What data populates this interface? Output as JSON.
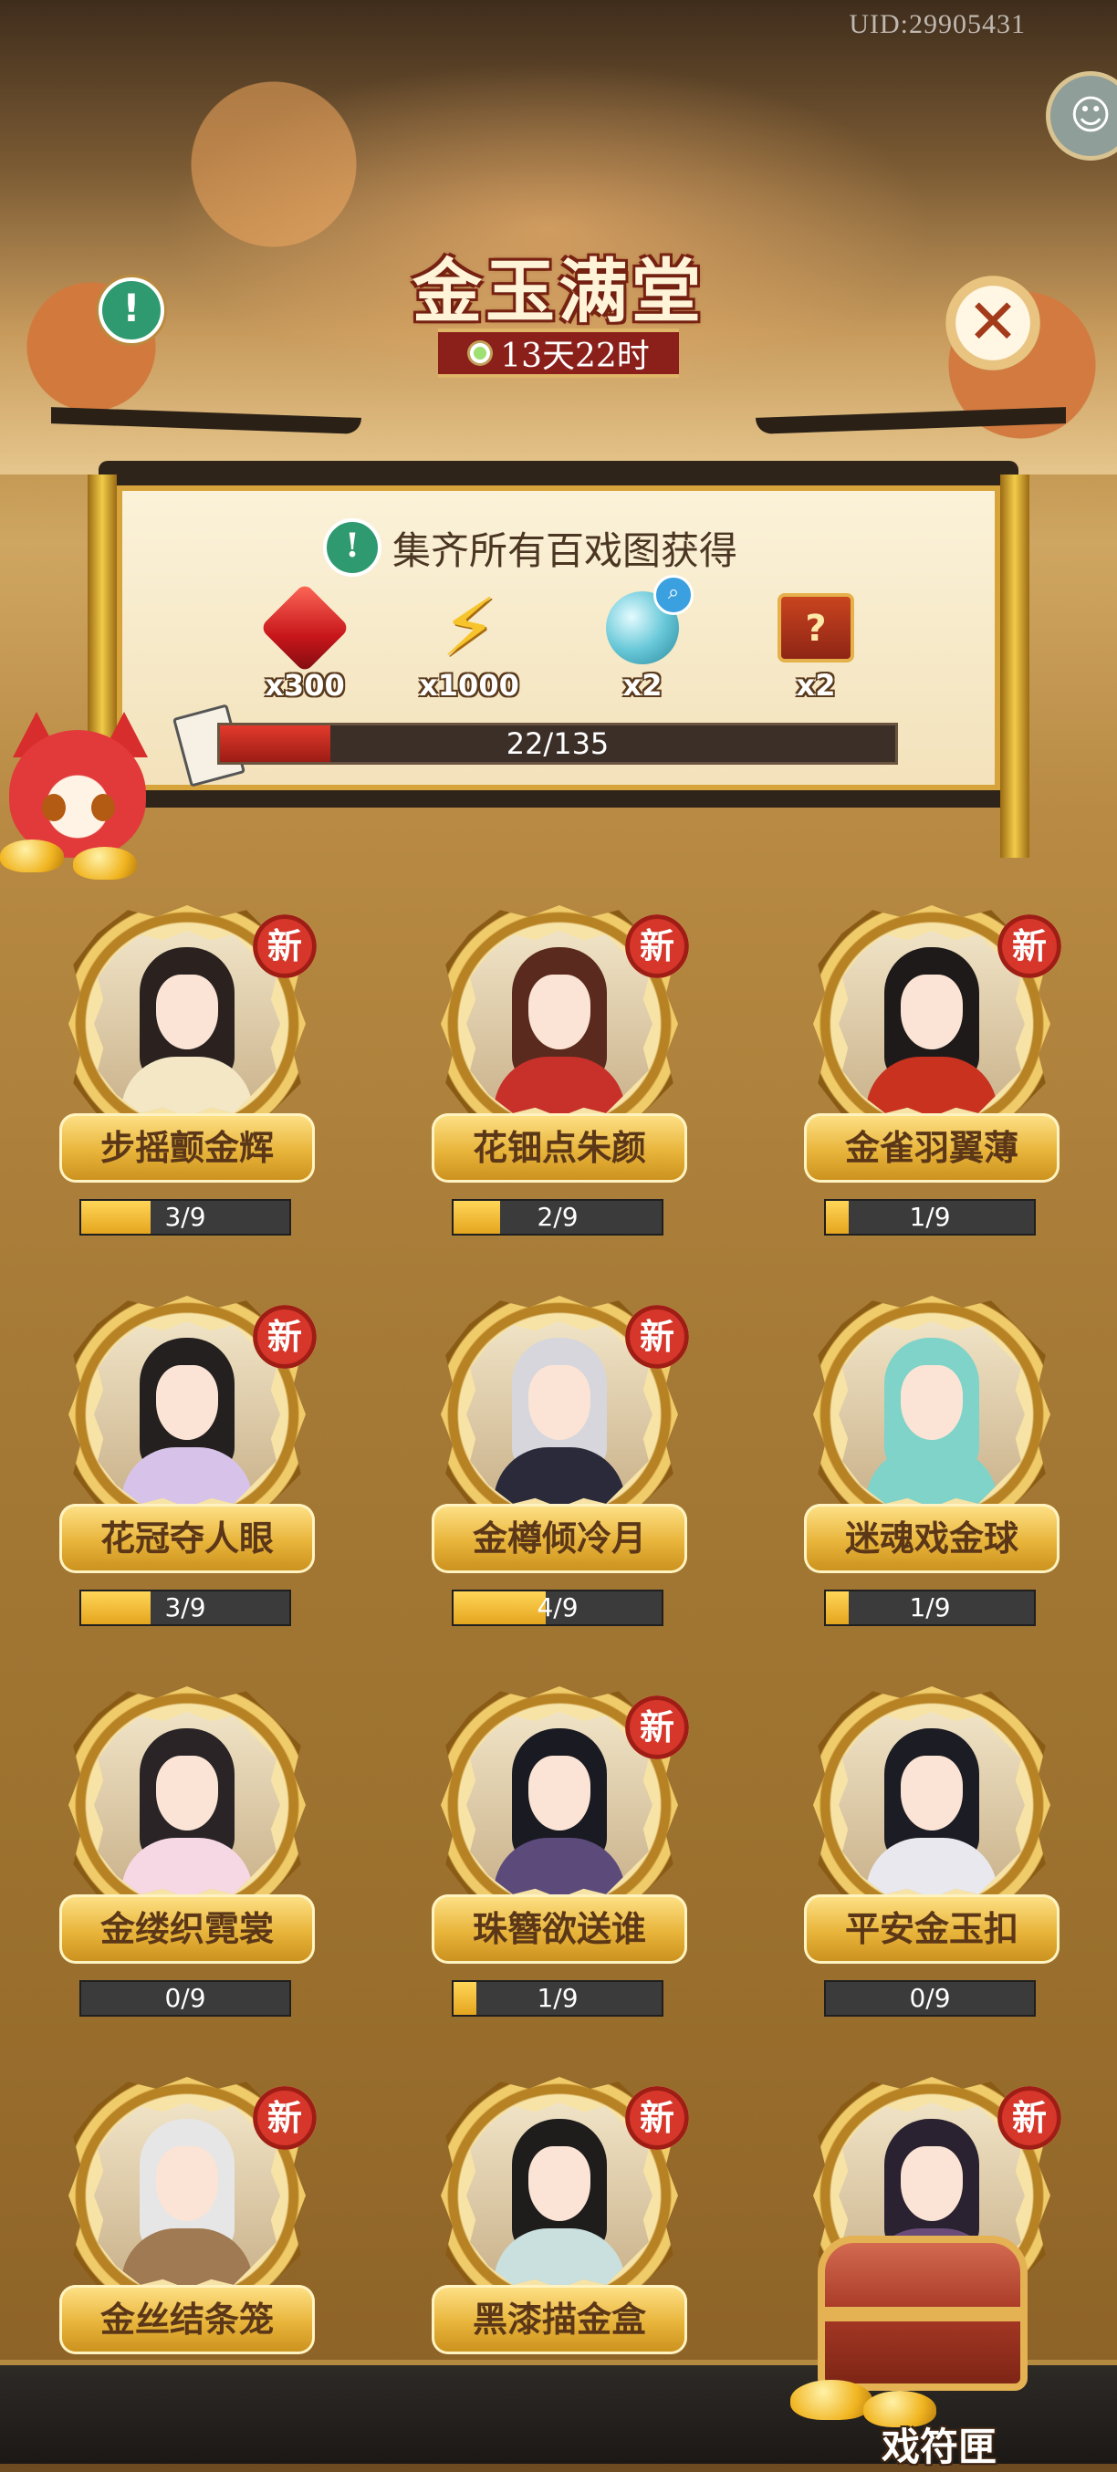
{
  "header": {
    "uid": "UID:29905431",
    "title": "金玉满堂",
    "timer": "13天22时"
  },
  "reward_panel": {
    "title": "集齐所有百戏图获得",
    "rewards": [
      {
        "icon": "ruby-gem-icon",
        "qty": "x300"
      },
      {
        "icon": "lightning-bolt-icon",
        "qty": "x1000"
      },
      {
        "icon": "crystal-orb-icon",
        "qty": "x2"
      },
      {
        "icon": "mystery-chest-icon",
        "qty": "x2"
      }
    ],
    "progress_text": "22/135",
    "progress_value": 22,
    "progress_max": 135
  },
  "new_label": "新",
  "cards": [
    {
      "name": "步摇颤金辉",
      "progress": "3/9",
      "fraction": 0.333,
      "is_new": true
    },
    {
      "name": "花钿点朱颜",
      "progress": "2/9",
      "fraction": 0.222,
      "is_new": true
    },
    {
      "name": "金雀羽翼薄",
      "progress": "1/9",
      "fraction": 0.111,
      "is_new": true
    },
    {
      "name": "花冠夺人眼",
      "progress": "3/9",
      "fraction": 0.333,
      "is_new": true
    },
    {
      "name": "金樽倾冷月",
      "progress": "4/9",
      "fraction": 0.444,
      "is_new": true
    },
    {
      "name": "迷魂戏金球",
      "progress": "1/9",
      "fraction": 0.111,
      "is_new": false
    },
    {
      "name": "金缕织霓裳",
      "progress": "0/9",
      "fraction": 0,
      "is_new": false
    },
    {
      "name": "珠簪欲送谁",
      "progress": "1/9",
      "fraction": 0.111,
      "is_new": true
    },
    {
      "name": "平安金玉扣",
      "progress": "0/9",
      "fraction": 0,
      "is_new": false
    },
    {
      "name": "金丝结条笼",
      "progress": "",
      "fraction": 0,
      "is_new": true
    },
    {
      "name": "黑漆描金盒",
      "progress": "",
      "fraction": 0,
      "is_new": true
    },
    {
      "name": "",
      "progress": "",
      "fraction": 0,
      "is_new": true
    }
  ],
  "chest_button": {
    "label": "戏符匣"
  }
}
